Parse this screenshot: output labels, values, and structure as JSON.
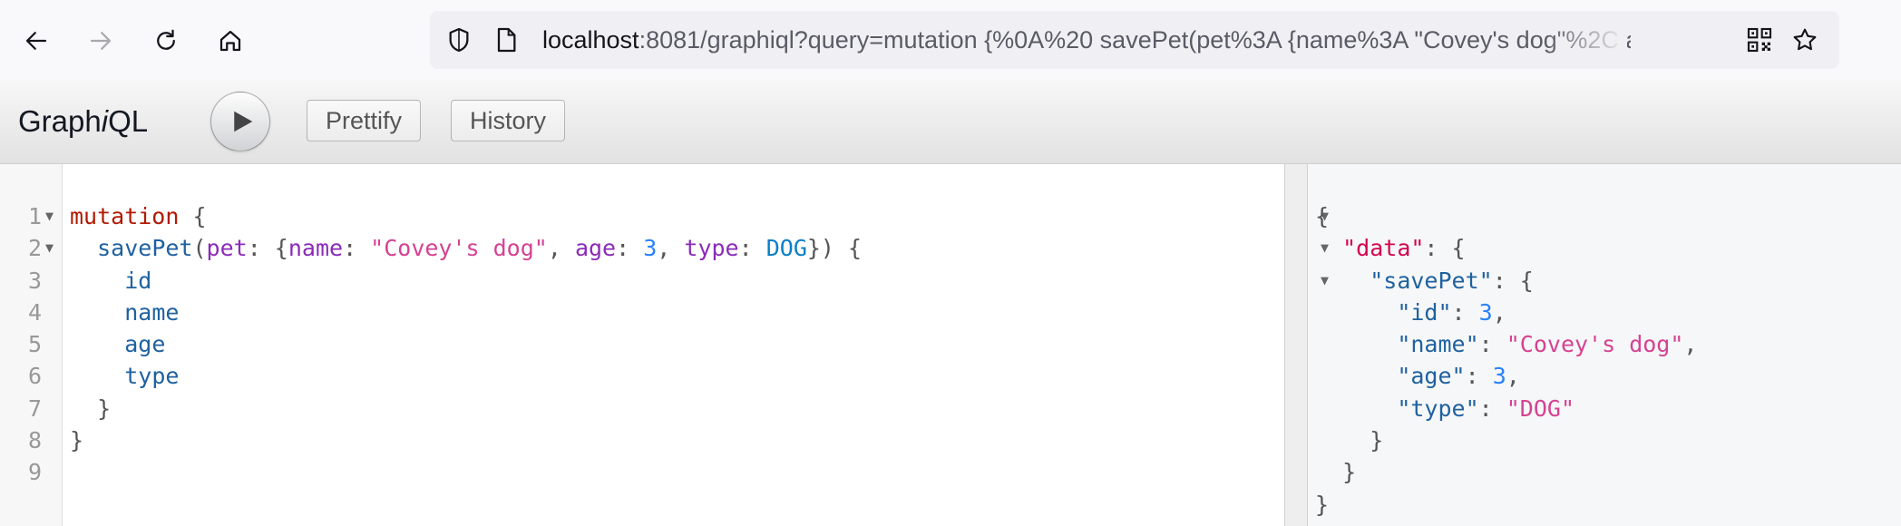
{
  "browser": {
    "url_host": "localhost",
    "url_rest": ":8081/graphiql?query=mutation {%0A%20 savePet(pet%3A {name%3A \"Covey's dog\"%2C ag"
  },
  "graphiql": {
    "title_prefix": "Graph",
    "title_italic": "i",
    "title_suffix": "QL",
    "prettify_label": "Prettify",
    "history_label": "History"
  },
  "query": {
    "line_numbers": [
      "1",
      "2",
      "3",
      "4",
      "5",
      "6",
      "7",
      "8",
      "9"
    ],
    "mutation_keyword": "mutation",
    "field": "savePet",
    "arg_name": "pet",
    "name_key": "name",
    "name_value": "\"Covey's dog\"",
    "age_key": "age",
    "age_value": "3",
    "type_key": "type",
    "type_value": "DOG",
    "selections": [
      "id",
      "name",
      "age",
      "type"
    ]
  },
  "result": {
    "data_key": "\"data\"",
    "savepet_key": "\"savePet\"",
    "id_key": "\"id\"",
    "id_value": "3",
    "name_key": "\"name\"",
    "name_value": "\"Covey's dog\"",
    "age_key": "\"age\"",
    "age_value": "3",
    "type_key": "\"type\"",
    "type_value": "\"DOG\""
  },
  "icons": {
    "back": "arrow-left-icon",
    "forward": "arrow-right-icon",
    "reload": "reload-icon",
    "home": "home-icon",
    "shield": "shield-icon",
    "page": "page-icon",
    "qr": "qr-code-icon",
    "bookmark": "star-icon",
    "run": "play-icon"
  }
}
